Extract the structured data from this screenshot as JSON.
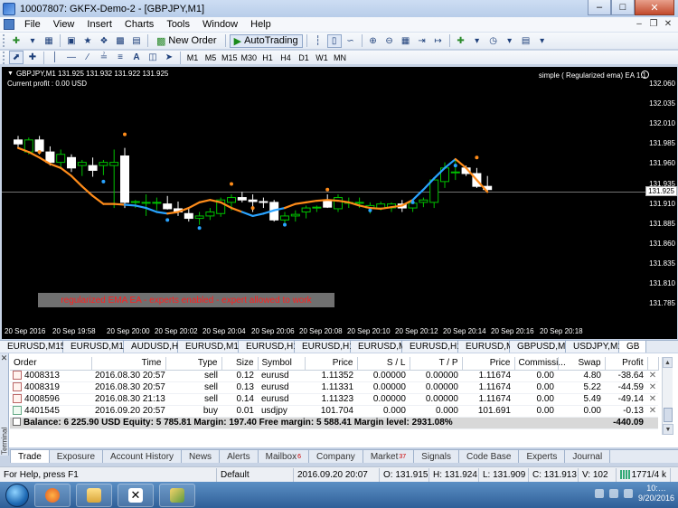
{
  "window": {
    "title": "10007807: GKFX-Demo-2 - [GBPJPY,M1]"
  },
  "menu": {
    "items": [
      "File",
      "View",
      "Insert",
      "Charts",
      "Tools",
      "Window",
      "Help"
    ]
  },
  "toolbar": {
    "new_order_label": "New Order",
    "autotrading_label": "AutoTrading",
    "timeframes": [
      "M1",
      "M5",
      "M15",
      "M30",
      "H1",
      "H4",
      "D1",
      "W1",
      "MN"
    ]
  },
  "chart": {
    "symbol_line": "GBPJPY,M1  131.925 131.932 131.922 131.925",
    "current_profit": "Current profit : 0.00 USD",
    "expert_label": "simple ( Regularized ema) EA 1.1",
    "status_banner": "regularized EMA EA - experts enabled - expert allowed to work",
    "current_price_label": "131.925",
    "colors": {
      "background": "#000000",
      "bull_candle": "#00c000",
      "bear_candle": "#ffffff",
      "ema_up": "#29a3ff",
      "ema_down": "#ff8c1a",
      "dots_up": "#29a3ff",
      "dots_down": "#ff8c1a",
      "banner_text": "#ff2020"
    }
  },
  "chart_data": {
    "type": "candlestick",
    "symbol": "GBPJPY",
    "timeframe": "M1",
    "ylim": [
      131.765,
      132.07
    ],
    "y_ticks": [
      "132.060",
      "132.035",
      "132.010",
      "131.985",
      "131.960",
      "131.935",
      "131.910",
      "131.885",
      "131.860",
      "131.835",
      "131.810",
      "131.785"
    ],
    "x_ticks": [
      "20 Sep 2016",
      "20 Sep 19:58",
      "20 Sep 20:00",
      "20 Sep 20:02",
      "20 Sep 20:04",
      "20 Sep 20:06",
      "20 Sep 20:08",
      "20 Sep 20:10",
      "20 Sep 20:12",
      "20 Sep 20:14",
      "20 Sep 20:16",
      "20 Sep 20:18"
    ],
    "current_price": 131.925,
    "candles": [
      {
        "o": 131.99,
        "h": 131.995,
        "l": 131.98,
        "c": 131.985
      },
      {
        "o": 131.975,
        "h": 131.993,
        "l": 131.972,
        "c": 131.99
      },
      {
        "o": 131.99,
        "h": 131.995,
        "l": 131.972,
        "c": 131.976
      },
      {
        "o": 131.975,
        "h": 131.982,
        "l": 131.958,
        "c": 131.962
      },
      {
        "o": 131.962,
        "h": 131.978,
        "l": 131.955,
        "c": 131.972
      },
      {
        "o": 131.968,
        "h": 131.972,
        "l": 131.95,
        "c": 131.955
      },
      {
        "o": 131.958,
        "h": 131.965,
        "l": 131.945,
        "c": 131.962
      },
      {
        "o": 131.958,
        "h": 131.968,
        "l": 131.944,
        "c": 131.952
      },
      {
        "o": 131.958,
        "h": 131.965,
        "l": 131.946,
        "c": 131.962
      },
      {
        "o": 131.958,
        "h": 131.978,
        "l": 131.905,
        "c": 131.962
      },
      {
        "o": 131.97,
        "h": 131.98,
        "l": 131.905,
        "c": 131.912
      },
      {
        "o": 131.912,
        "h": 131.915,
        "l": 131.905,
        "c": 131.913
      },
      {
        "o": 131.912,
        "h": 131.922,
        "l": 131.895,
        "c": 131.912
      },
      {
        "o": 131.912,
        "h": 131.918,
        "l": 131.902,
        "c": 131.912
      },
      {
        "o": 131.91,
        "h": 131.92,
        "l": 131.903,
        "c": 131.904
      },
      {
        "o": 131.904,
        "h": 131.913,
        "l": 131.895,
        "c": 131.9
      },
      {
        "o": 131.898,
        "h": 131.905,
        "l": 131.888,
        "c": 131.892
      },
      {
        "o": 131.892,
        "h": 131.9,
        "l": 131.884,
        "c": 131.895
      },
      {
        "o": 131.895,
        "h": 131.905,
        "l": 131.89,
        "c": 131.9
      },
      {
        "o": 131.898,
        "h": 131.918,
        "l": 131.894,
        "c": 131.915
      },
      {
        "o": 131.912,
        "h": 131.922,
        "l": 131.902,
        "c": 131.918
      },
      {
        "o": 131.918,
        "h": 131.925,
        "l": 131.912,
        "c": 131.915
      },
      {
        "o": 131.915,
        "h": 131.922,
        "l": 131.9,
        "c": 131.913
      },
      {
        "o": 131.913,
        "h": 131.918,
        "l": 131.905,
        "c": 131.912
      },
      {
        "o": 131.912,
        "h": 131.915,
        "l": 131.888,
        "c": 131.89
      },
      {
        "o": 131.89,
        "h": 131.9,
        "l": 131.883,
        "c": 131.895
      },
      {
        "o": 131.895,
        "h": 131.902,
        "l": 131.888,
        "c": 131.897
      },
      {
        "o": 131.9,
        "h": 131.908,
        "l": 131.892,
        "c": 131.905
      },
      {
        "o": 131.905,
        "h": 131.908,
        "l": 131.9,
        "c": 131.906
      },
      {
        "o": 131.914,
        "h": 131.922,
        "l": 131.905,
        "c": 131.906
      },
      {
        "o": 131.904,
        "h": 131.922,
        "l": 131.9,
        "c": 131.918
      },
      {
        "o": 131.912,
        "h": 131.918,
        "l": 131.905,
        "c": 131.912
      },
      {
        "o": 131.912,
        "h": 131.918,
        "l": 131.905,
        "c": 131.912
      },
      {
        "o": 131.905,
        "h": 131.912,
        "l": 131.898,
        "c": 131.908
      },
      {
        "o": 131.905,
        "h": 131.913,
        "l": 131.902,
        "c": 131.91
      },
      {
        "o": 131.905,
        "h": 131.912,
        "l": 131.9,
        "c": 131.91
      },
      {
        "o": 131.91,
        "h": 131.915,
        "l": 131.9,
        "c": 131.905
      },
      {
        "o": 131.905,
        "h": 131.915,
        "l": 131.9,
        "c": 131.911
      },
      {
        "o": 131.912,
        "h": 131.918,
        "l": 131.906,
        "c": 131.915
      },
      {
        "o": 131.912,
        "h": 131.942,
        "l": 131.905,
        "c": 131.94
      },
      {
        "o": 131.938,
        "h": 131.962,
        "l": 131.93,
        "c": 131.955
      },
      {
        "o": 131.95,
        "h": 131.965,
        "l": 131.94,
        "c": 131.95
      },
      {
        "o": 131.955,
        "h": 131.958,
        "l": 131.945,
        "c": 131.948
      },
      {
        "o": 131.948,
        "h": 131.955,
        "l": 131.93,
        "c": 131.932
      },
      {
        "o": 131.932,
        "h": 131.945,
        "l": 131.925,
        "c": 131.928
      }
    ],
    "ema_line": [
      131.98,
      131.975,
      131.968,
      131.96,
      131.955,
      131.945,
      131.932,
      131.92,
      131.91,
      131.91,
      131.909,
      131.908,
      131.905,
      131.9,
      131.898,
      131.9,
      131.905,
      131.912,
      131.915,
      131.912,
      131.905,
      131.9,
      131.895,
      131.898,
      131.902,
      131.905,
      131.91,
      131.912,
      131.914,
      131.915,
      131.914,
      131.912,
      131.908,
      131.905,
      131.904,
      131.906,
      131.908,
      131.915,
      131.928,
      131.942,
      131.955,
      131.966,
      131.955,
      131.94,
      131.925
    ],
    "ema_color_up_segments": [
      [
        10,
        14
      ],
      [
        21,
        25
      ],
      [
        37,
        41
      ]
    ],
    "dots": [
      {
        "i": 2,
        "y": 131.975,
        "dir": "down"
      },
      {
        "i": 8,
        "y": 131.938,
        "dir": "up"
      },
      {
        "i": 10,
        "y": 131.997,
        "dir": "down"
      },
      {
        "i": 14,
        "y": 131.89,
        "dir": "up"
      },
      {
        "i": 17,
        "y": 131.88,
        "dir": "up"
      },
      {
        "i": 20,
        "y": 131.935,
        "dir": "down"
      },
      {
        "i": 22,
        "y": 131.905,
        "dir": "down"
      },
      {
        "i": 25,
        "y": 131.884,
        "dir": "up"
      },
      {
        "i": 29,
        "y": 131.928,
        "dir": "down"
      },
      {
        "i": 33,
        "y": 131.902,
        "dir": "up"
      },
      {
        "i": 37,
        "y": 131.912,
        "dir": "up"
      },
      {
        "i": 41,
        "y": 131.958,
        "dir": "up"
      },
      {
        "i": 43,
        "y": 131.968,
        "dir": "down"
      }
    ]
  },
  "symbol_tabs": [
    "EURUSD,M15",
    "EURUSD,M15",
    "AUDUSD,H1",
    "EURUSD,M15",
    "EURUSD,H1",
    "EURUSD,H1",
    "EURUSD,M1",
    "EURUSD,H1",
    "EURUSD,M1",
    "GBPUSD,M1",
    "USDJPY,M1",
    "GB"
  ],
  "orders": {
    "columns": [
      "Order",
      "Time",
      "Type",
      "Size",
      "Symbol",
      "Price",
      "S / L",
      "T / P",
      "Price",
      "Commissi...",
      "Swap",
      "Profit"
    ],
    "rows": [
      {
        "order": "4008313",
        "time": "2016.08.30 20:57:32",
        "type": "sell",
        "size": "0.12",
        "symbol": "eurusd",
        "price": "1.11352",
        "sl": "0.00000",
        "tp": "0.00000",
        "cur_price": "1.11674",
        "commission": "0.00",
        "swap": "4.80",
        "profit": "-38.64"
      },
      {
        "order": "4008319",
        "time": "2016.08.30 20:57:35",
        "type": "sell",
        "size": "0.13",
        "symbol": "eurusd",
        "price": "1.11331",
        "sl": "0.00000",
        "tp": "0.00000",
        "cur_price": "1.11674",
        "commission": "0.00",
        "swap": "5.22",
        "profit": "-44.59"
      },
      {
        "order": "4008596",
        "time": "2016.08.30 21:13:15",
        "type": "sell",
        "size": "0.14",
        "symbol": "eurusd",
        "price": "1.11323",
        "sl": "0.00000",
        "tp": "0.00000",
        "cur_price": "1.11674",
        "commission": "0.00",
        "swap": "5.49",
        "profit": "-49.14"
      },
      {
        "order": "4401545",
        "time": "2016.09.20 20:57:01",
        "type": "buy",
        "size": "0.01",
        "symbol": "usdjpy",
        "price": "101.704",
        "sl": "0.000",
        "tp": "0.000",
        "cur_price": "101.691",
        "commission": "0.00",
        "swap": "0.00",
        "profit": "-0.13"
      }
    ],
    "balance_line": "Balance: 6 225.90 USD  Equity: 5 785.81  Margin: 197.40  Free margin: 5 588.41  Margin level: 2931.08%",
    "total_profit": "-440.09"
  },
  "terminal": {
    "side_label": "Terminal",
    "tabs": [
      {
        "label": "Trade",
        "badge": ""
      },
      {
        "label": "Exposure",
        "badge": ""
      },
      {
        "label": "Account History",
        "badge": ""
      },
      {
        "label": "News",
        "badge": ""
      },
      {
        "label": "Alerts",
        "badge": ""
      },
      {
        "label": "Mailbox",
        "badge": "6"
      },
      {
        "label": "Company",
        "badge": ""
      },
      {
        "label": "Market",
        "badge": "37"
      },
      {
        "label": "Signals",
        "badge": ""
      },
      {
        "label": "Code Base",
        "badge": ""
      },
      {
        "label": "Experts",
        "badge": ""
      },
      {
        "label": "Journal",
        "badge": ""
      }
    ]
  },
  "statusbar": {
    "help": "For Help, press F1",
    "profile": "Default",
    "datetime": "2016.09.20 20:07",
    "open": "O: 131.915",
    "high": "H: 131.924",
    "low": "L: 131.909",
    "close": "C: 131.913",
    "volume": "V: 102",
    "traffic": "1771/4 k"
  },
  "taskbar": {
    "time": "10:…",
    "date": "9/20/2016"
  }
}
